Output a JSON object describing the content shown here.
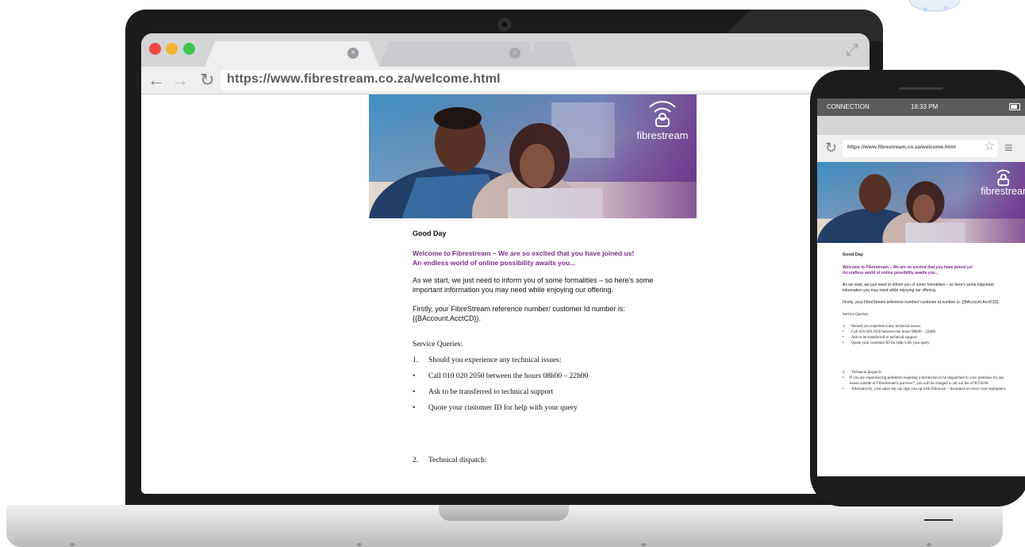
{
  "browser": {
    "url": "https://www.fibrestream.co.za/welcome.html",
    "tab_close_glyph": "×"
  },
  "brand": {
    "logo_text": "fibrestream"
  },
  "email": {
    "greeting": "Good Day",
    "welcome_line1": "Welcome to Fibrestream – We are so excited that you have joined us!",
    "welcome_line2": "An endless world of online possibility awaits you...",
    "intro": "As we start, we just need to inform you of some formalities – so here's some important information you may need while enjoying our offering.",
    "reference": "Firstly, your FibreStream reference number/ customer Id number is: {{BAccount.AcctCD}}.",
    "service_title": "Service Queries:",
    "items": [
      {
        "marker": "1.",
        "text": "Should you experience any technical issues:"
      },
      {
        "marker": "•",
        "text": "Call 010 020 2050 between the hours 08h00 – 22h00"
      },
      {
        "marker": "•",
        "text": "Ask to be transferred to technical support"
      },
      {
        "marker": "•",
        "text": "Quote your customer ID for help with your query"
      }
    ],
    "dispatch_marker": "2.",
    "dispatch_title": "Technical dispatch:"
  },
  "phone": {
    "carrier": "CONNECTION",
    "time": "18:33 PM",
    "url": "https://www.fibrestream.co.za/welcome.html",
    "dispatch_text": "If you are experiencing problems requiring a technician to be dispatched to your premises for any issues outside of FibreStream's purview*, you will be charged a call out fee of R750.00.",
    "insurance_text": "Alternatively, your sales rep can sign you up with Fibrecare – Insurance to cover your equipment."
  },
  "colors": {
    "brand_purple": "#7b2b8c",
    "traffic_red": "#ee4b46",
    "traffic_yellow": "#f3b433",
    "traffic_green": "#38c749"
  }
}
